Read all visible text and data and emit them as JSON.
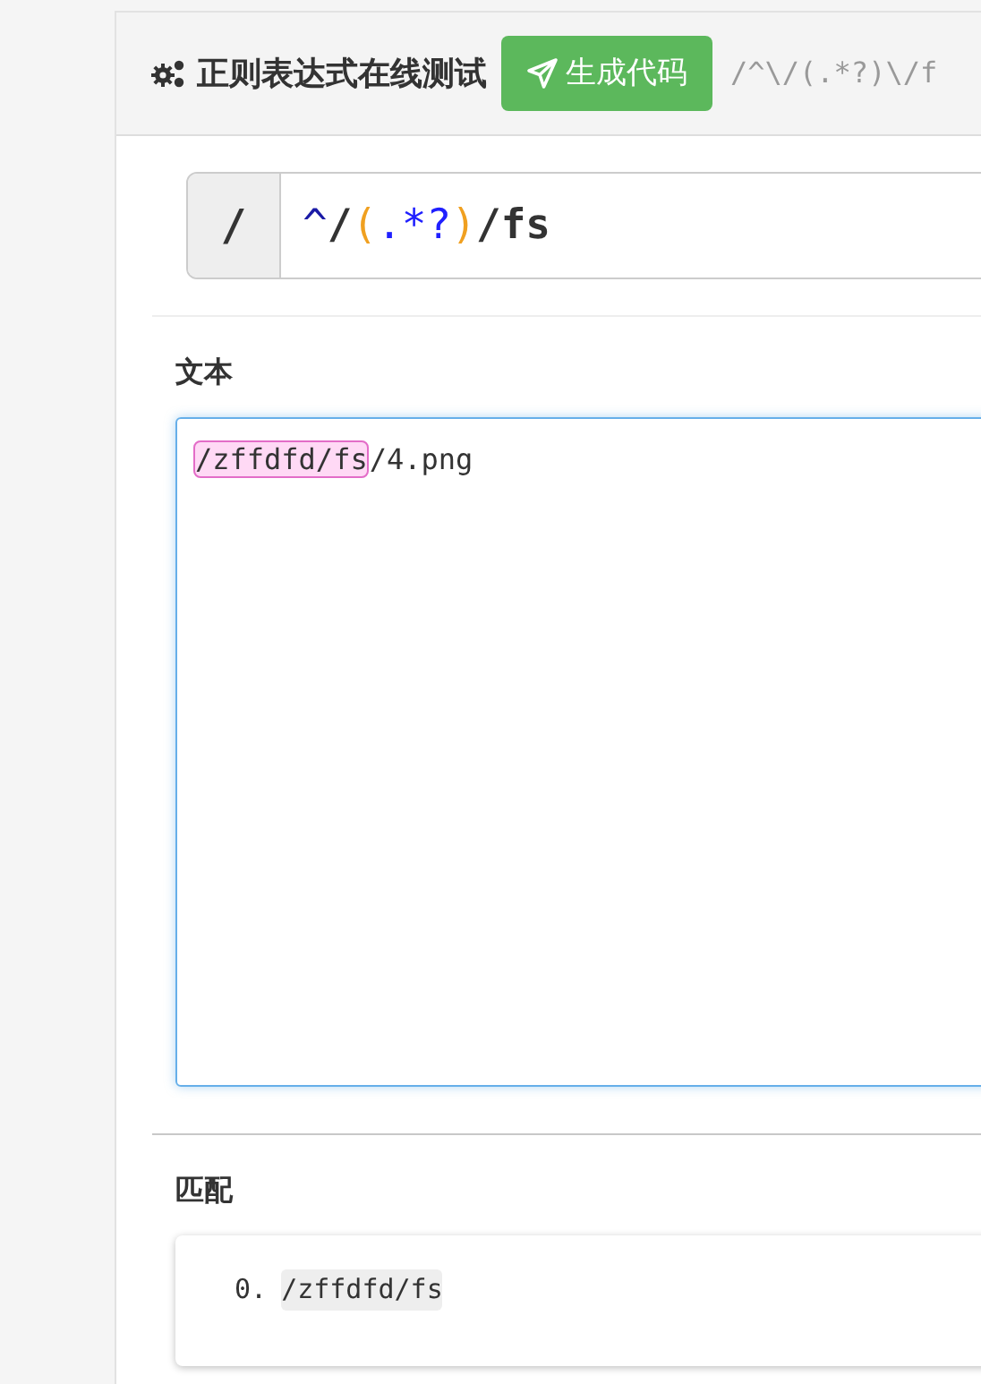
{
  "header": {
    "title": "正则表达式在线测试",
    "generate_button": "生成代码",
    "regex_preview": "/^\\/(.*?)\\/f"
  },
  "regex": {
    "delimiter": "/",
    "tokens": [
      {
        "text": "^",
        "kind": "anchor"
      },
      {
        "text": "/",
        "kind": "literal"
      },
      {
        "text": "(",
        "kind": "group"
      },
      {
        "text": ".*?",
        "kind": "quantifier"
      },
      {
        "text": ")",
        "kind": "group"
      },
      {
        "text": "/fs",
        "kind": "literal"
      }
    ]
  },
  "text_section": {
    "label": "文本",
    "segments": [
      {
        "text": "/zffdfd/fs",
        "matched": true
      },
      {
        "text": "/4.png",
        "matched": false
      }
    ]
  },
  "matches_section": {
    "label": "匹配",
    "items": [
      {
        "index": "0.",
        "value": "/zffdfd/fs"
      }
    ]
  }
}
